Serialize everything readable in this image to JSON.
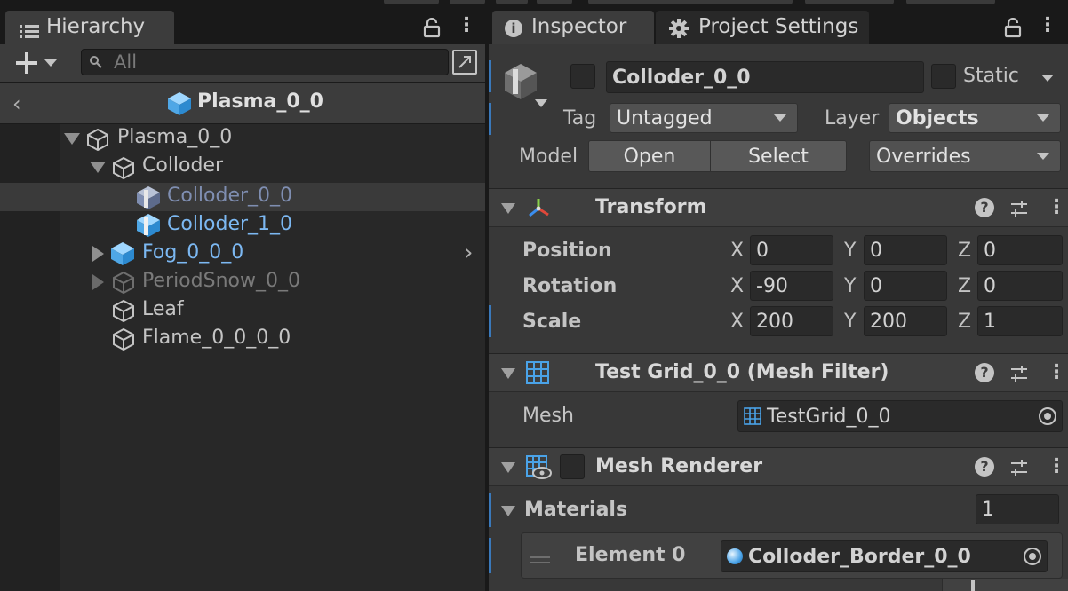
{
  "hierarchy": {
    "tab_label": "Hierarchy",
    "search_placeholder": "All",
    "scene_title": "Plasma_0_0",
    "tree": [
      {
        "label": "Plasma_0_0",
        "color": "#c4c4c4"
      },
      {
        "label": "Colloder",
        "color": "#c4c4c4"
      },
      {
        "label": "Colloder_0_0",
        "color": "#7f8eb1"
      },
      {
        "label": "Colloder_1_0",
        "color": "#7cb8f2"
      },
      {
        "label": "Fog_0_0_0",
        "color": "#7cb8f2"
      },
      {
        "label": "PeriodSnow_0_0",
        "color": "#7a7a7a"
      },
      {
        "label": "Leaf",
        "color": "#c4c4c4"
      },
      {
        "label": "Flame_0_0_0_0",
        "color": "#c4c4c4"
      }
    ]
  },
  "inspector": {
    "tabs": [
      "Inspector",
      "Project Settings"
    ],
    "object_name": "Colloder_0_0",
    "static_label": "Static",
    "tag_label": "Tag",
    "tag_value": "Untagged",
    "layer_label": "Layer",
    "layer_value": "Objects",
    "model_label": "Model",
    "open_label": "Open",
    "select_label": "Select",
    "overrides_label": "Overrides",
    "transform": {
      "title": "Transform",
      "position_label": "Position",
      "rotation_label": "Rotation",
      "scale_label": "Scale",
      "axis_x": "X",
      "axis_y": "Y",
      "axis_z": "Z",
      "position": {
        "x": "0",
        "y": "0",
        "z": "0"
      },
      "rotation": {
        "x": "-90",
        "y": "0",
        "z": "0"
      },
      "scale": {
        "x": "200",
        "y": "200",
        "z": "1"
      }
    },
    "mesh_filter": {
      "title": "Test Grid_0_0 (Mesh Filter)",
      "mesh_label": "Mesh",
      "mesh_value": "TestGrid_0_0"
    },
    "mesh_renderer": {
      "title": "Mesh Renderer",
      "materials_label": "Materials",
      "materials_count": "1",
      "element_label": "Element 0",
      "element_value": "Colloder_Border_0_0"
    }
  },
  "colors": {
    "accent_blue": "#3a79bb",
    "prefab_blue": "#7cb8f2"
  }
}
